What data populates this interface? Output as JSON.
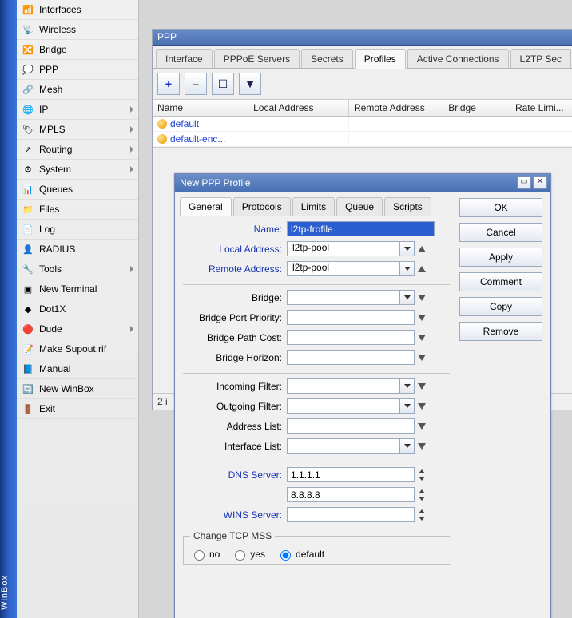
{
  "winbox_label": "WinBox",
  "nav": [
    {
      "label": "Interfaces",
      "icon": "📶",
      "arrow": false
    },
    {
      "label": "Wireless",
      "icon": "📡",
      "arrow": false
    },
    {
      "label": "Bridge",
      "icon": "🔀",
      "arrow": false
    },
    {
      "label": "PPP",
      "icon": "💭",
      "arrow": false
    },
    {
      "label": "Mesh",
      "icon": "🔗",
      "arrow": false
    },
    {
      "label": "IP",
      "icon": "🌐",
      "arrow": true
    },
    {
      "label": "MPLS",
      "icon": "🏷",
      "arrow": true
    },
    {
      "label": "Routing",
      "icon": "↗",
      "arrow": true
    },
    {
      "label": "System",
      "icon": "⚙",
      "arrow": true
    },
    {
      "label": "Queues",
      "icon": "📊",
      "arrow": false
    },
    {
      "label": "Files",
      "icon": "📁",
      "arrow": false
    },
    {
      "label": "Log",
      "icon": "📄",
      "arrow": false
    },
    {
      "label": "RADIUS",
      "icon": "👤",
      "arrow": false
    },
    {
      "label": "Tools",
      "icon": "🔧",
      "arrow": true
    },
    {
      "label": "New Terminal",
      "icon": "▣",
      "arrow": false
    },
    {
      "label": "Dot1X",
      "icon": "◆",
      "arrow": false
    },
    {
      "label": "Dude",
      "icon": "🔴",
      "arrow": true
    },
    {
      "label": "Make Supout.rif",
      "icon": "📝",
      "arrow": false
    },
    {
      "label": "Manual",
      "icon": "📘",
      "arrow": false
    },
    {
      "label": "New WinBox",
      "icon": "🔄",
      "arrow": false
    },
    {
      "label": "Exit",
      "icon": "🚪",
      "arrow": false
    }
  ],
  "ppp": {
    "title": "PPP",
    "tabs": [
      "Interface",
      "PPPoE Servers",
      "Secrets",
      "Profiles",
      "Active Connections",
      "L2TP Sec"
    ],
    "active_tab": 3,
    "columns": [
      "Name",
      "Local Address",
      "Remote Address",
      "Bridge",
      "Rate Limi..."
    ],
    "rows": [
      {
        "name": "default"
      },
      {
        "name": "default-enc..."
      }
    ],
    "status": "2 i"
  },
  "dialog": {
    "title": "New PPP Profile",
    "tabs": [
      "General",
      "Protocols",
      "Limits",
      "Queue",
      "Scripts"
    ],
    "active_tab": 0,
    "side": [
      "OK",
      "Cancel",
      "Apply",
      "Comment",
      "Copy",
      "Remove"
    ],
    "fields": {
      "name_label": "Name:",
      "name_value": "l2tp-frofile",
      "local_label": "Local Address:",
      "local_value": "l2tp-pool",
      "remote_label": "Remote Address:",
      "remote_value": "l2tp-pool",
      "bridge_label": "Bridge:",
      "bpp_label": "Bridge Port Priority:",
      "bpc_label": "Bridge Path Cost:",
      "bh_label": "Bridge Horizon:",
      "if_label": "Incoming Filter:",
      "of_label": "Outgoing Filter:",
      "al_label": "Address List:",
      "il_label": "Interface List:",
      "dns_label": "DNS Server:",
      "dns1": "1.1.1.1",
      "dns2": "8.8.8.8",
      "wins_label": "WINS Server:",
      "mss_legend": "Change TCP MSS",
      "mss_no": "no",
      "mss_yes": "yes",
      "mss_default": "default"
    }
  }
}
